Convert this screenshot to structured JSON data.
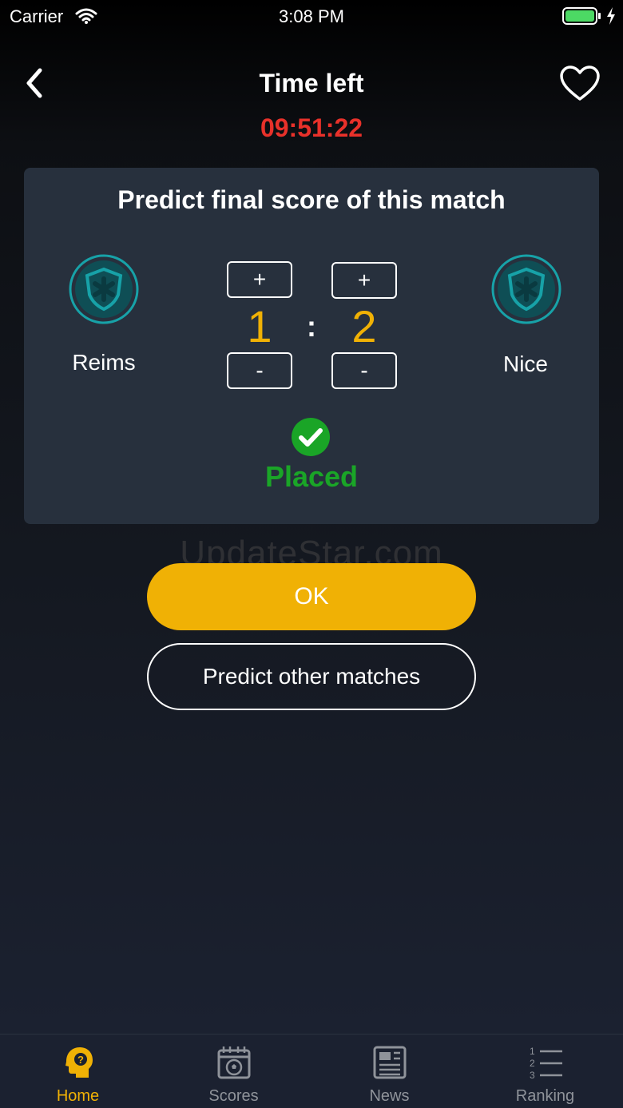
{
  "status_bar": {
    "carrier": "Carrier",
    "time": "3:08 PM",
    "icons": [
      "wifi-icon",
      "battery-icon",
      "charging-icon"
    ]
  },
  "header": {
    "title": "Time left",
    "countdown": "09:51:22",
    "back_icon": "chevron-left-icon",
    "favorite_icon": "heart-outline-icon"
  },
  "prediction": {
    "title": "Predict final score of this match",
    "home_team": {
      "name": "Reims",
      "logo_icon": "shield-logo-icon",
      "score": "1"
    },
    "away_team": {
      "name": "Nice",
      "logo_icon": "shield-logo-icon",
      "score": "2"
    },
    "separator": ":",
    "increment_label": "+",
    "decrement_label": "-",
    "status": "Placed",
    "status_icon": "check-circle-icon"
  },
  "watermark": "UpdateStar.com",
  "actions": {
    "ok_label": "OK",
    "predict_other_label": "Predict other matches"
  },
  "tabs": [
    {
      "label": "Home",
      "icon": "head-question-icon",
      "active": true
    },
    {
      "label": "Scores",
      "icon": "calendar-ball-icon",
      "active": false
    },
    {
      "label": "News",
      "icon": "newspaper-icon",
      "active": false
    },
    {
      "label": "Ranking",
      "icon": "ranked-list-icon",
      "active": false
    }
  ],
  "colors": {
    "accent": "#f0b105",
    "countdown": "#e8312a",
    "placed": "#1aa527",
    "card_bg": "#27303d",
    "team_logo": "#17a2a8",
    "inactive_tab": "#8f939a"
  }
}
